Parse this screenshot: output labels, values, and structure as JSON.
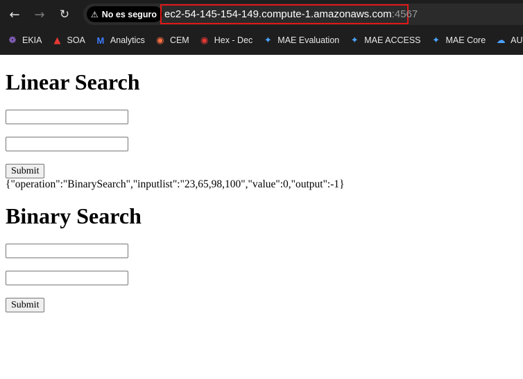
{
  "browser": {
    "security_label": "No es seguro",
    "url_host": "ec2-54-145-154-149.compute-1.amazonaws.com",
    "url_port": ":4567",
    "bookmarks": [
      {
        "label": "EKIA",
        "icon": "ekia-icon"
      },
      {
        "label": "SOA",
        "icon": "angular-icon"
      },
      {
        "label": "Analytics",
        "icon": "analytics-icon"
      },
      {
        "label": "CEM",
        "icon": "cem-icon"
      },
      {
        "label": "Hex - Dec",
        "icon": "location-pin-icon"
      },
      {
        "label": "MAE Evaluation",
        "icon": "mae-icon"
      },
      {
        "label": "MAE ACCESS",
        "icon": "mae-icon"
      },
      {
        "label": "MAE Core",
        "icon": "mae-icon"
      },
      {
        "label": "AUTIN",
        "icon": "cloud-icon"
      }
    ]
  },
  "linear": {
    "title": "Linear Search",
    "submit_label": "Submit",
    "result": "{\"operation\":\"BinarySearch\",\"inputlist\":\"23,65,98,100\",\"value\":0,\"output\":-1}"
  },
  "binary": {
    "title": "Binary Search",
    "submit_label": "Submit"
  }
}
